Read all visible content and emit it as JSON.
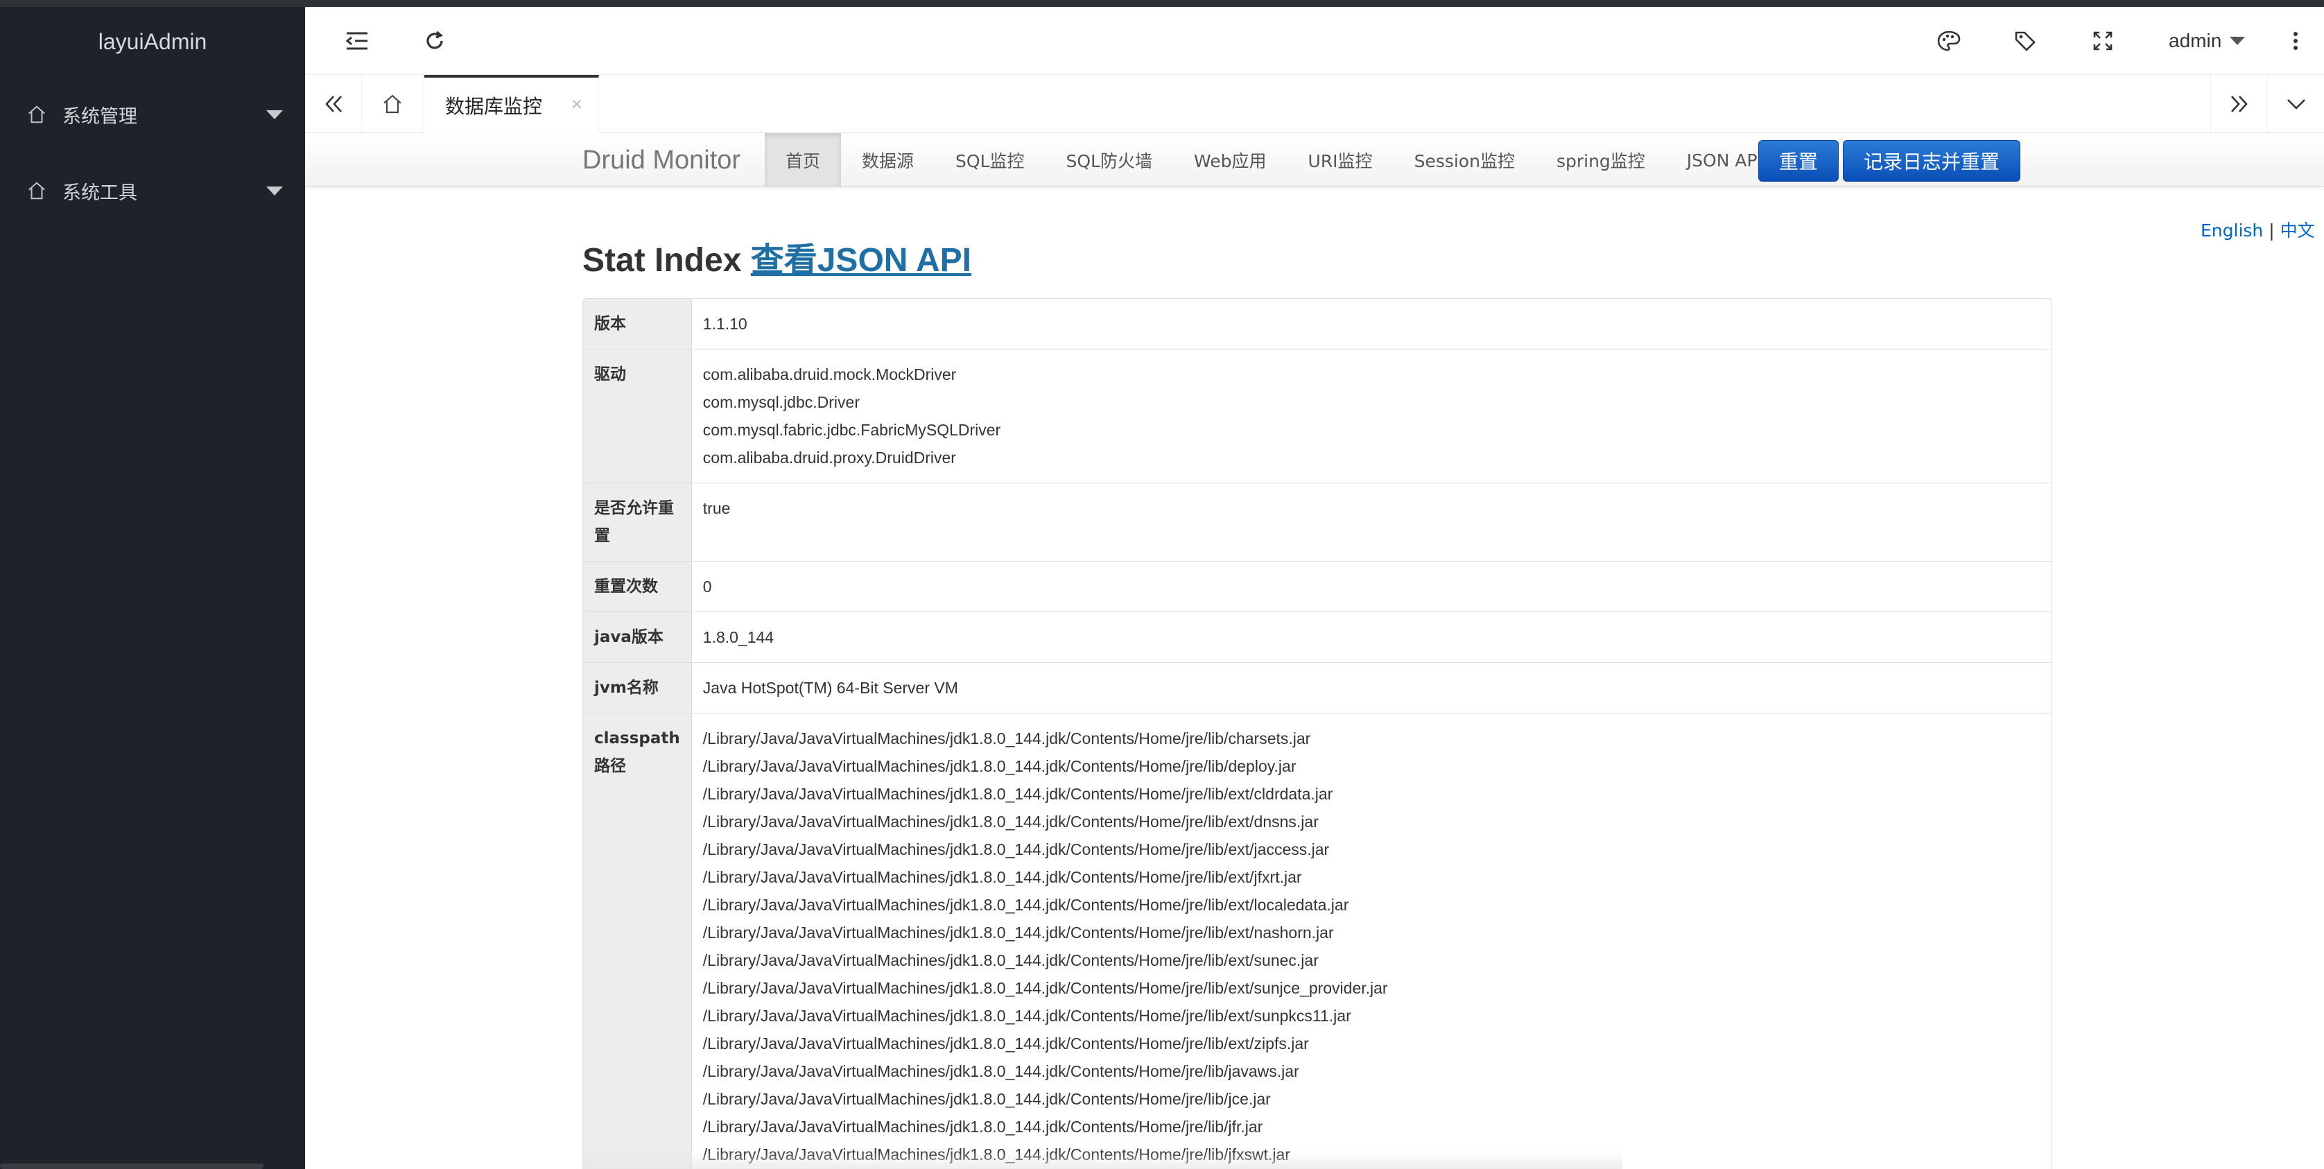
{
  "app": {
    "logo": "layuiAdmin"
  },
  "sidebar": {
    "items": [
      {
        "label": "系统管理",
        "icon": "home-icon"
      },
      {
        "label": "系统工具",
        "icon": "home-icon"
      }
    ]
  },
  "header": {
    "user": "admin",
    "icons": [
      "menu-shrink-icon",
      "refresh-icon",
      "theme-palette-icon",
      "tag-icon",
      "fullscreen-icon",
      "more-vertical-icon"
    ]
  },
  "tabs": {
    "active": {
      "label": "数据库监控",
      "close": "×"
    }
  },
  "druid": {
    "brand": "Druid Monitor",
    "nav": [
      "首页",
      "数据源",
      "SQL监控",
      "SQL防火墙",
      "Web应用",
      "URI监控",
      "Session监控",
      "spring监控",
      "JSON API"
    ],
    "buttons": {
      "reset": "重置",
      "log_reset": "记录日志并重置"
    },
    "lang": {
      "english": "English",
      "sep": "|",
      "chinese": "中文"
    },
    "title": {
      "prefix": "Stat Index",
      "link": "查看JSON API"
    }
  },
  "stats": [
    {
      "key": "版本",
      "values": [
        "1.1.10"
      ]
    },
    {
      "key": "驱动",
      "values": [
        "com.alibaba.druid.mock.MockDriver",
        "com.mysql.jdbc.Driver",
        "com.mysql.fabric.jdbc.FabricMySQLDriver",
        "com.alibaba.druid.proxy.DruidDriver"
      ]
    },
    {
      "key": "是否允许重置",
      "values": [
        "true"
      ]
    },
    {
      "key": "重置次数",
      "values": [
        "0"
      ]
    },
    {
      "key": "java版本",
      "values": [
        "1.8.0_144"
      ]
    },
    {
      "key": "jvm名称",
      "values": [
        "Java HotSpot(TM) 64-Bit Server VM"
      ]
    },
    {
      "key": "classpath路径",
      "values": [
        "/Library/Java/JavaVirtualMachines/jdk1.8.0_144.jdk/Contents/Home/jre/lib/charsets.jar",
        "/Library/Java/JavaVirtualMachines/jdk1.8.0_144.jdk/Contents/Home/jre/lib/deploy.jar",
        "/Library/Java/JavaVirtualMachines/jdk1.8.0_144.jdk/Contents/Home/jre/lib/ext/cldrdata.jar",
        "/Library/Java/JavaVirtualMachines/jdk1.8.0_144.jdk/Contents/Home/jre/lib/ext/dnsns.jar",
        "/Library/Java/JavaVirtualMachines/jdk1.8.0_144.jdk/Contents/Home/jre/lib/ext/jaccess.jar",
        "/Library/Java/JavaVirtualMachines/jdk1.8.0_144.jdk/Contents/Home/jre/lib/ext/jfxrt.jar",
        "/Library/Java/JavaVirtualMachines/jdk1.8.0_144.jdk/Contents/Home/jre/lib/ext/localedata.jar",
        "/Library/Java/JavaVirtualMachines/jdk1.8.0_144.jdk/Contents/Home/jre/lib/ext/nashorn.jar",
        "/Library/Java/JavaVirtualMachines/jdk1.8.0_144.jdk/Contents/Home/jre/lib/ext/sunec.jar",
        "/Library/Java/JavaVirtualMachines/jdk1.8.0_144.jdk/Contents/Home/jre/lib/ext/sunjce_provider.jar",
        "/Library/Java/JavaVirtualMachines/jdk1.8.0_144.jdk/Contents/Home/jre/lib/ext/sunpkcs11.jar",
        "/Library/Java/JavaVirtualMachines/jdk1.8.0_144.jdk/Contents/Home/jre/lib/ext/zipfs.jar",
        "/Library/Java/JavaVirtualMachines/jdk1.8.0_144.jdk/Contents/Home/jre/lib/javaws.jar",
        "/Library/Java/JavaVirtualMachines/jdk1.8.0_144.jdk/Contents/Home/jre/lib/jce.jar",
        "/Library/Java/JavaVirtualMachines/jdk1.8.0_144.jdk/Contents/Home/jre/lib/jfr.jar",
        "/Library/Java/JavaVirtualMachines/jdk1.8.0_144.jdk/Contents/Home/jre/lib/jfxswt.jar"
      ]
    }
  ]
}
